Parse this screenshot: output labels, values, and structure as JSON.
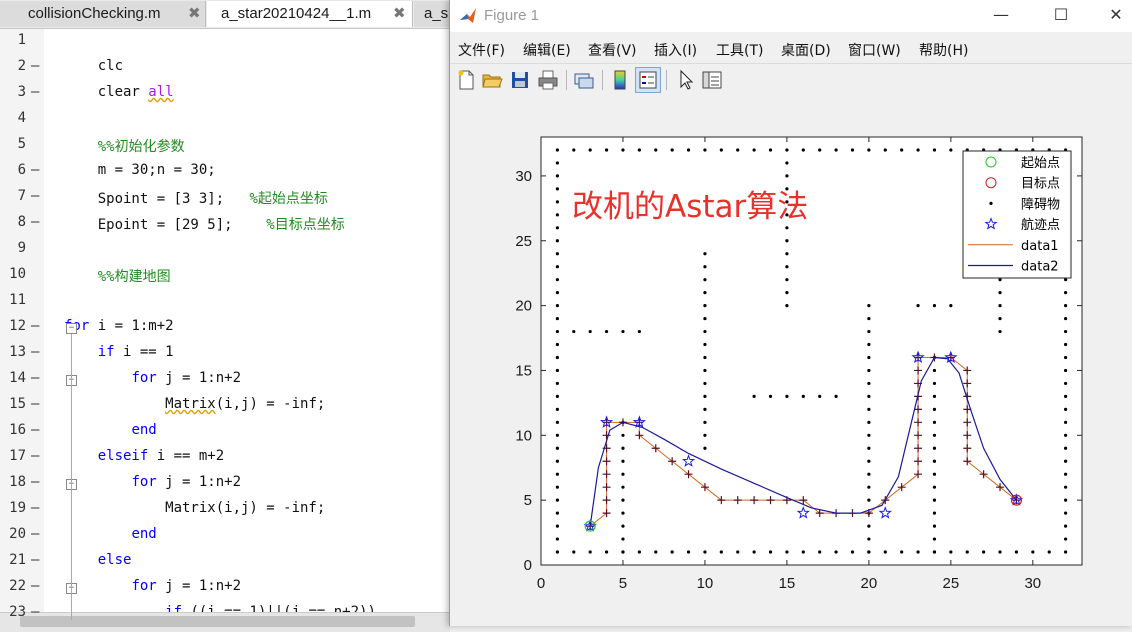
{
  "editor": {
    "tabs": [
      {
        "label": "collisionChecking.m",
        "active": false,
        "close": "✖"
      },
      {
        "label": "a_star20210424__1.m",
        "active": true,
        "close": "✖"
      },
      {
        "label": "a_s",
        "active": false
      }
    ],
    "lines": [
      {
        "n": "1",
        "dash": "",
        "fold": "",
        "code": ""
      },
      {
        "n": "2",
        "dash": "—",
        "fold": "",
        "code": "    clc"
      },
      {
        "n": "3",
        "dash": "—",
        "fold": "",
        "code": "    clear all"
      },
      {
        "n": "4",
        "dash": "",
        "fold": "",
        "code": ""
      },
      {
        "n": "5",
        "dash": "",
        "fold": "",
        "code": "    %%初始化参数"
      },
      {
        "n": "6",
        "dash": "—",
        "fold": "",
        "code": "    m = 30;n = 30;"
      },
      {
        "n": "7",
        "dash": "—",
        "fold": "",
        "code": "    Spoint = [3 3];   %起始点坐标"
      },
      {
        "n": "8",
        "dash": "—",
        "fold": "",
        "code": "    Epoint = [29 5];    %目标点坐标"
      },
      {
        "n": "9",
        "dash": "",
        "fold": "",
        "code": ""
      },
      {
        "n": "10",
        "dash": "",
        "fold": "",
        "code": "    %%构建地图"
      },
      {
        "n": "11",
        "dash": "",
        "fold": "",
        "code": ""
      },
      {
        "n": "12",
        "dash": "—",
        "fold": "−",
        "code": "for i = 1:m+2"
      },
      {
        "n": "13",
        "dash": "—",
        "fold": "",
        "code": "    if i == 1"
      },
      {
        "n": "14",
        "dash": "—",
        "fold": "−",
        "code": "        for j = 1:n+2"
      },
      {
        "n": "15",
        "dash": "—",
        "fold": "",
        "code": "            Matrix(i,j) = -inf;"
      },
      {
        "n": "16",
        "dash": "—",
        "fold": "",
        "code": "        end"
      },
      {
        "n": "17",
        "dash": "—",
        "fold": "",
        "code": "    elseif i == m+2"
      },
      {
        "n": "18",
        "dash": "—",
        "fold": "−",
        "code": "        for j = 1:n+2"
      },
      {
        "n": "19",
        "dash": "—",
        "fold": "",
        "code": "            Matrix(i,j) = -inf;"
      },
      {
        "n": "20",
        "dash": "—",
        "fold": "",
        "code": "        end"
      },
      {
        "n": "21",
        "dash": "—",
        "fold": "",
        "code": "    else"
      },
      {
        "n": "22",
        "dash": "—",
        "fold": "−",
        "code": "        for j = 1:n+2"
      },
      {
        "n": "23",
        "dash": "—",
        "fold": "",
        "code": "            if ((i == 1)||(j == n+2))"
      }
    ]
  },
  "figure": {
    "title": "Figure 1",
    "window_buttons": {
      "minimize": "—",
      "maximize": "☐",
      "close": "✕"
    },
    "menus": [
      "文件(F)",
      "编辑(E)",
      "查看(V)",
      "插入(I)",
      "工具(T)",
      "桌面(D)",
      "窗口(W)",
      "帮助(H)"
    ],
    "toolbar_icons": [
      "new-figure-icon",
      "open-file-icon",
      "save-icon",
      "print-icon",
      "link-icon",
      "colorbar-icon",
      "legend-icon",
      "pointer-icon",
      "property-editor-icon"
    ],
    "colors": {
      "start": "#22cc22",
      "target": "#cc2222",
      "obstacle": "#000000",
      "waypoint": "#1a1aee",
      "data1": "#d2691e",
      "data2": "#1a1a99",
      "annotation": "#e8312b"
    }
  },
  "chart_data": {
    "type": "scatter",
    "annotation": "改机的Astar算法",
    "xlim": [
      0,
      33
    ],
    "ylim": [
      0,
      33
    ],
    "xticks": [
      0,
      5,
      10,
      15,
      20,
      25,
      30
    ],
    "yticks": [
      0,
      5,
      10,
      15,
      20,
      25,
      30
    ],
    "grid": false,
    "legend_position": "top-right",
    "legend": [
      "起始点",
      "目标点",
      "障碍物",
      "航迹点",
      "data1",
      "data2"
    ],
    "series": [
      {
        "name": "起始点",
        "kind": "marker",
        "marker": "circle",
        "points": [
          [
            3,
            3
          ]
        ]
      },
      {
        "name": "目标点",
        "kind": "marker",
        "marker": "circle",
        "points": [
          [
            29,
            5
          ]
        ]
      },
      {
        "name": "障碍物",
        "kind": "obstacle",
        "border": {
          "xmin": 1,
          "xmax": 32,
          "ymin": 1,
          "ymax": 32
        },
        "segments": [
          {
            "x": [
              2,
              6
            ],
            "y": [
              18,
              18
            ]
          },
          {
            "x": [
              5,
              5
            ],
            "y": [
              1,
              11
            ]
          },
          {
            "x": [
              10,
              10
            ],
            "y": [
              9,
              24
            ]
          },
          {
            "x": [
              13,
              18
            ],
            "y": [
              13,
              13
            ]
          },
          {
            "x": [
              15,
              15
            ],
            "y": [
              20,
              31
            ]
          },
          {
            "x": [
              20,
              20
            ],
            "y": [
              1,
              20
            ]
          },
          {
            "x": [
              23,
              25
            ],
            "y": [
              20,
              20
            ]
          },
          {
            "x": [
              24,
              24
            ],
            "y": [
              1,
              16
            ]
          },
          {
            "x": [
              28,
              28
            ],
            "y": [
              18,
              24
            ]
          }
        ]
      },
      {
        "name": "航迹点",
        "kind": "marker",
        "marker": "star",
        "points": [
          [
            3,
            3
          ],
          [
            4,
            11
          ],
          [
            6,
            11
          ],
          [
            9,
            8
          ],
          [
            16,
            4
          ],
          [
            21,
            4
          ],
          [
            23,
            16
          ],
          [
            25,
            16
          ],
          [
            29,
            5
          ]
        ]
      },
      {
        "name": "data1",
        "kind": "line",
        "marker": "plus",
        "points": [
          [
            3,
            3
          ],
          [
            4,
            4
          ],
          [
            4,
            5
          ],
          [
            4,
            6
          ],
          [
            4,
            7
          ],
          [
            4,
            8
          ],
          [
            4,
            9
          ],
          [
            4,
            10
          ],
          [
            4,
            11
          ],
          [
            5,
            11
          ],
          [
            6,
            11
          ],
          [
            6,
            10
          ],
          [
            7,
            9
          ],
          [
            8,
            8
          ],
          [
            9,
            7
          ],
          [
            10,
            6
          ],
          [
            11,
            5
          ],
          [
            12,
            5
          ],
          [
            13,
            5
          ],
          [
            14,
            5
          ],
          [
            15,
            5
          ],
          [
            16,
            5
          ],
          [
            17,
            4
          ],
          [
            18,
            4
          ],
          [
            19,
            4
          ],
          [
            20,
            4
          ],
          [
            21,
            5
          ],
          [
            22,
            6
          ],
          [
            23,
            7
          ],
          [
            23,
            8
          ],
          [
            23,
            9
          ],
          [
            23,
            10
          ],
          [
            23,
            11
          ],
          [
            23,
            12
          ],
          [
            23,
            13
          ],
          [
            23,
            14
          ],
          [
            23,
            15
          ],
          [
            23,
            16
          ],
          [
            24,
            16
          ],
          [
            25,
            16
          ],
          [
            26,
            15
          ],
          [
            26,
            14
          ],
          [
            26,
            13
          ],
          [
            26,
            12
          ],
          [
            26,
            11
          ],
          [
            26,
            10
          ],
          [
            26,
            9
          ],
          [
            26,
            8
          ],
          [
            27,
            7
          ],
          [
            28,
            6
          ],
          [
            29,
            5
          ]
        ]
      },
      {
        "name": "data2",
        "kind": "line",
        "marker": "none",
        "points": [
          [
            3,
            3
          ],
          [
            3.5,
            7.5
          ],
          [
            4.2,
            10.4
          ],
          [
            5,
            11
          ],
          [
            6.2,
            10.6
          ],
          [
            7.5,
            9.7
          ],
          [
            9,
            8.6
          ],
          [
            11,
            7.4
          ],
          [
            13,
            6.3
          ],
          [
            15,
            5.2
          ],
          [
            16.5,
            4.4
          ],
          [
            18,
            4
          ],
          [
            19.5,
            4
          ],
          [
            20.8,
            4.6
          ],
          [
            21.8,
            6.8
          ],
          [
            22.5,
            10.5
          ],
          [
            23.2,
            14.2
          ],
          [
            24,
            16
          ],
          [
            24.8,
            15.9
          ],
          [
            25.5,
            14.8
          ],
          [
            26.2,
            12
          ],
          [
            27,
            9
          ],
          [
            28,
            6.6
          ],
          [
            29,
            5
          ]
        ]
      }
    ]
  }
}
